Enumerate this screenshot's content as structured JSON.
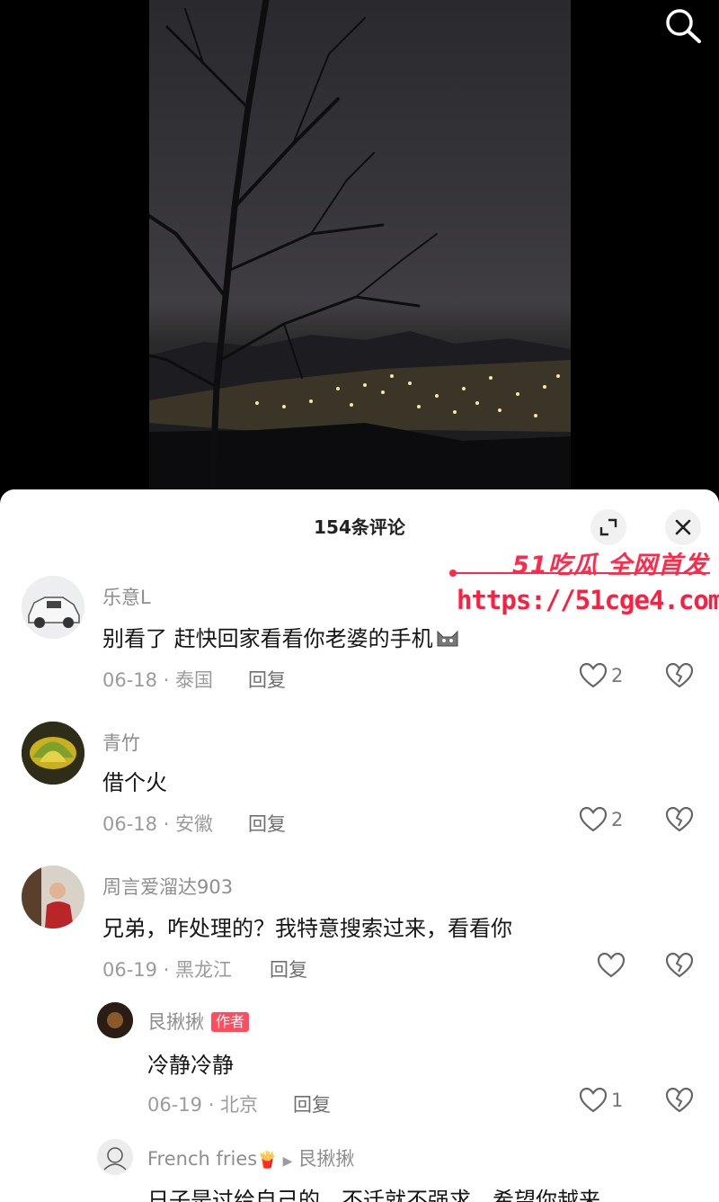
{
  "panel": {
    "title": "154条评论"
  },
  "watermark": {
    "brand": "51吃瓜 全网首发",
    "url": "https://51cge4.com"
  },
  "icons": {
    "search": "search-icon",
    "expand": "expand-icon",
    "close": "close-icon",
    "like": "heart-icon",
    "dislike": "broken-heart-icon"
  },
  "comments": [
    {
      "user": "乐意L",
      "text": "别看了 赶快回家看看你老婆的手机",
      "emoji": "cat-face-emoji",
      "meta": "06-18 · 泰国",
      "reply": "回复",
      "likes": "2"
    },
    {
      "user": "青竹",
      "text": "借个火",
      "meta": "06-18 · 安徽",
      "reply": "回复",
      "likes": "2"
    },
    {
      "user": "周言爱溜达903",
      "text": "兄弟，咋处理的？我特意搜索过来，看看你",
      "meta": "06-19 · 黑龙江",
      "reply": "回复",
      "likes": ""
    }
  ],
  "replies": [
    {
      "user": "艮揪揪",
      "badge": "作者",
      "text": "冷静冷静",
      "meta": "06-19 · 北京",
      "reply": "回复",
      "likes": "1"
    },
    {
      "user": "French fries",
      "fries_icon": "🍟",
      "reply_to": "艮揪揪",
      "text": "日子是过给自己的，不迁就不强求，希望你越来"
    }
  ],
  "colors": {
    "accent": "#ff2a4a",
    "badge": "#ff4d5f",
    "meta": "#9b9b9b"
  }
}
